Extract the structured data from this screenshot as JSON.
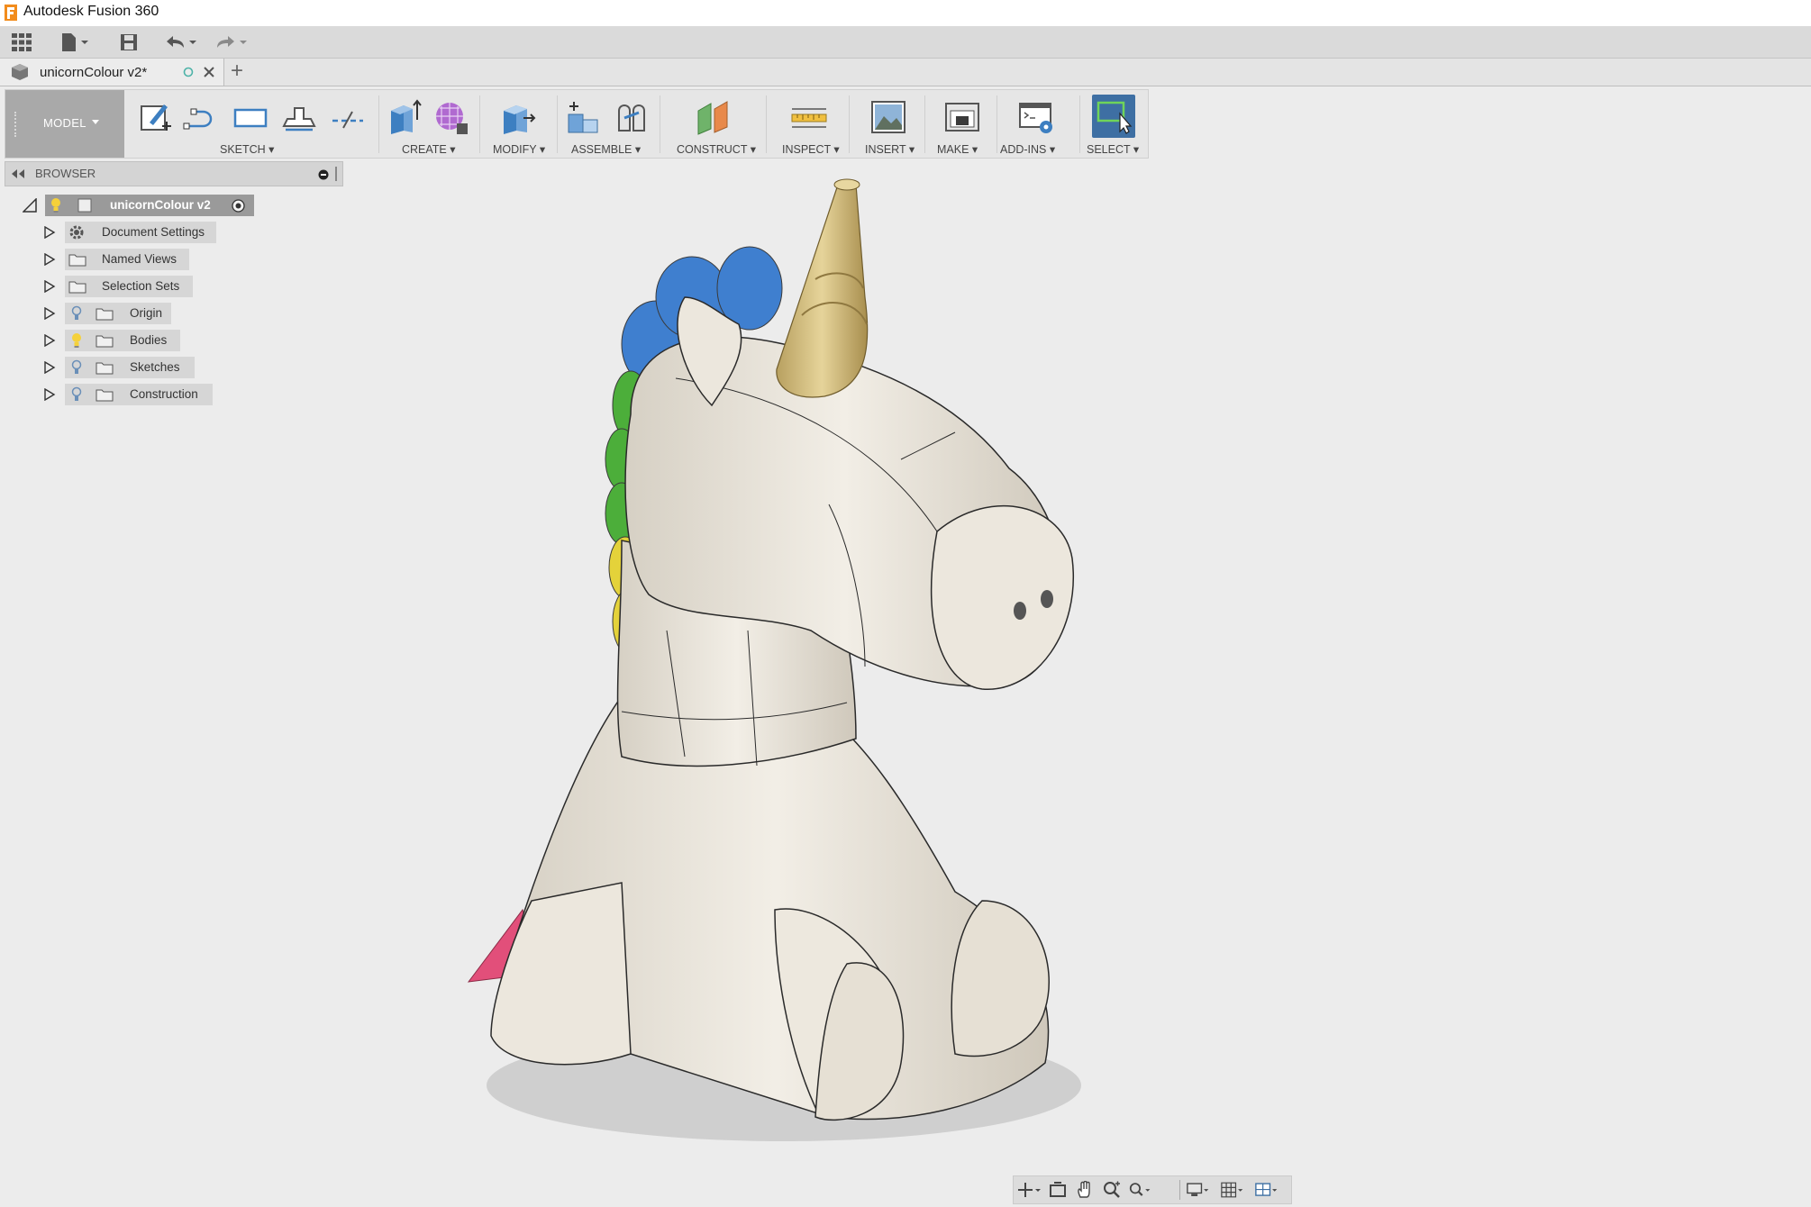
{
  "app": {
    "title": "Autodesk Fusion 360"
  },
  "document": {
    "tab_name": "unicornColour v2*"
  },
  "ribbon": {
    "workspace": "MODEL",
    "groups": [
      {
        "label": "SKETCH ▾"
      },
      {
        "label": "CREATE ▾"
      },
      {
        "label": "MODIFY ▾"
      },
      {
        "label": "ASSEMBLE ▾"
      },
      {
        "label": "CONSTRUCT ▾"
      },
      {
        "label": "INSPECT ▾"
      },
      {
        "label": "INSERT ▾"
      },
      {
        "label": "MAKE ▾"
      },
      {
        "label": "ADD-INS ▾"
      },
      {
        "label": "SELECT ▾"
      }
    ]
  },
  "browser": {
    "title": "BROWSER",
    "root": "unicornColour v2",
    "items": [
      {
        "label": "Document Settings",
        "icon": "gear-icon"
      },
      {
        "label": "Named Views",
        "icon": "folder-icon"
      },
      {
        "label": "Selection Sets",
        "icon": "folder-icon"
      },
      {
        "label": "Origin",
        "icon": "folder-icon",
        "visibility": "off"
      },
      {
        "label": "Bodies",
        "icon": "folder-icon",
        "visibility": "on"
      },
      {
        "label": "Sketches",
        "icon": "folder-icon",
        "visibility": "off"
      },
      {
        "label": "Construction",
        "icon": "folder-icon",
        "visibility": "off"
      }
    ]
  },
  "colors": {
    "ribbon_bg": "#e6e6e6",
    "workspace_bg": "#a9a9a9",
    "select_active": "#3e6fa3",
    "viewport_bg": "#ececec",
    "model_body": "#ebe6dc",
    "horn": "#d9c48a",
    "mane_blue": "#3f7fcf",
    "mane_green": "#4cae3a",
    "mane_yellow": "#e4d23a",
    "tail_pink": "#e24f7a"
  }
}
